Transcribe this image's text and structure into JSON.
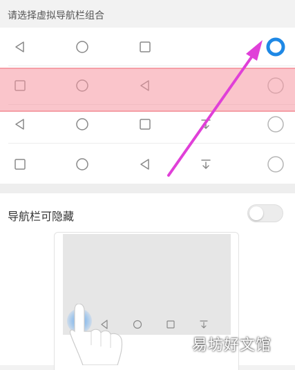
{
  "combo_section": {
    "title": "请选择虚拟导航栏组合",
    "rows": [
      {
        "keys": [
          "back",
          "home",
          "recent"
        ],
        "selected": true
      },
      {
        "keys": [
          "recent",
          "home",
          "back"
        ],
        "selected": false
      },
      {
        "keys": [
          "back",
          "home",
          "recent",
          "notification"
        ],
        "selected": false
      },
      {
        "keys": [
          "recent",
          "home",
          "back",
          "notification"
        ],
        "selected": false
      }
    ]
  },
  "hide_toggle": {
    "label": "导航栏可隐藏",
    "enabled": false
  },
  "icons": {
    "back": "triangle-back-icon",
    "home": "circle-home-icon",
    "recent": "square-recent-icon",
    "notification": "pull-down-notification-icon"
  },
  "colors": {
    "accent": "#1e88e5",
    "annotation_arrow": "#e040d8",
    "highlight": "#f5a0a8"
  },
  "watermark": "易坊好文馆"
}
